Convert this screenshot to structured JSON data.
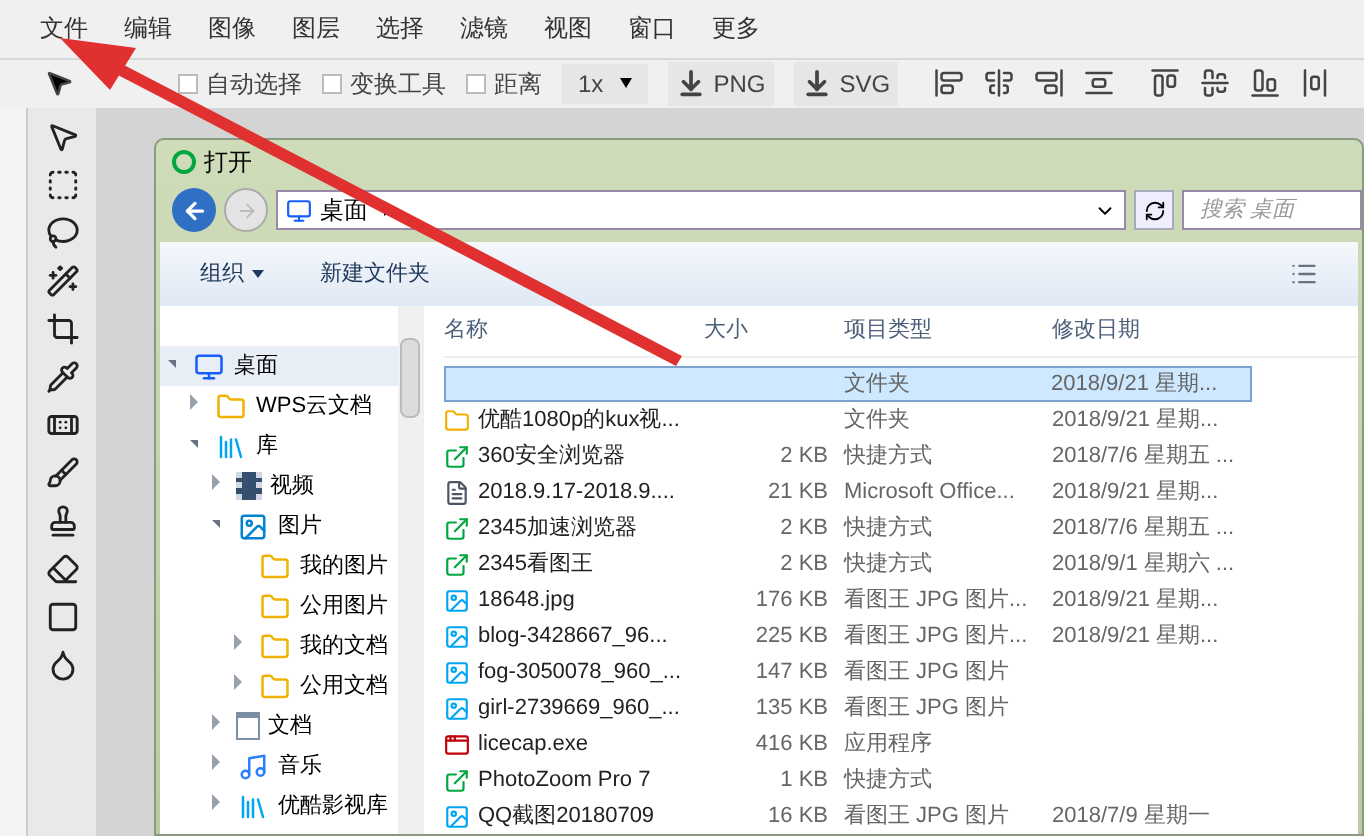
{
  "menu": [
    "文件",
    "编辑",
    "图像",
    "图层",
    "选择",
    "滤镜",
    "视图",
    "窗口",
    "更多"
  ],
  "options": {
    "checkboxes": [
      {
        "label": "自动选择",
        "checked": false
      },
      {
        "label": "变换工具",
        "checked": false
      },
      {
        "label": "距离",
        "checked": false
      }
    ],
    "scale": "1x",
    "exports": [
      "PNG",
      "SVG"
    ]
  },
  "dialog": {
    "title": "打开",
    "address": "桌面",
    "search": {
      "placeholder": "搜索 桌面"
    },
    "toolbar": {
      "organize": "组织",
      "new_folder": "新建文件夹"
    },
    "tree": [
      {
        "label": "桌面",
        "kind": "desktop",
        "expanded": true,
        "selected": true,
        "children": [
          {
            "label": "WPS云文档",
            "kind": "folder",
            "expanded": false,
            "selected": false
          },
          {
            "label": "库",
            "kind": "library",
            "expanded": true,
            "selected": false,
            "children": [
              {
                "label": "视频",
                "kind": "video",
                "expanded": false,
                "selected": false
              },
              {
                "label": "图片",
                "kind": "pictures",
                "expanded": true,
                "selected": false,
                "children": [
                  {
                    "label": "我的图片",
                    "kind": "folder",
                    "selected": false
                  },
                  {
                    "label": "公用图片",
                    "kind": "folder",
                    "selected": false
                  },
                  {
                    "label": "我的文档",
                    "kind": "folder",
                    "expanded": false,
                    "selected": false
                  },
                  {
                    "label": "公用文档",
                    "kind": "folder",
                    "expanded": false,
                    "selected": false
                  }
                ]
              },
              {
                "label": "文档",
                "kind": "document",
                "expanded": false,
                "selected": false
              },
              {
                "label": "音乐",
                "kind": "music",
                "expanded": false,
                "selected": false
              },
              {
                "label": "优酷影视库",
                "kind": "library",
                "expanded": false,
                "selected": false
              }
            ]
          }
        ]
      }
    ],
    "columns": [
      "名称",
      "大小",
      "项目类型",
      "修改日期"
    ],
    "files": [
      {
        "kind": "folder",
        "type": "文件夹",
        "date": "2018/9/21 星期...",
        "selected": true
      },
      {
        "kind": "folder",
        "name": "优酷1080p的kux视...",
        "type": "文件夹",
        "date": "2018/9/21 星期...",
        "selected": false
      },
      {
        "kind": "shortcut",
        "name": "360安全浏览器",
        "size": "2 KB",
        "type": "快捷方式",
        "date": "2018/7/6 星期五 ...",
        "selected": false
      },
      {
        "kind": "document",
        "name": "2018.9.17-2018.9....",
        "size": "21 KB",
        "type": "Microsoft Office...",
        "date": "2018/9/21 星期...",
        "selected": false
      },
      {
        "kind": "shortcut",
        "name": "2345加速浏览器",
        "size": "2 KB",
        "type": "快捷方式",
        "date": "2018/7/6 星期五 ...",
        "selected": false
      },
      {
        "kind": "shortcut",
        "name": "2345看图王",
        "size": "2 KB",
        "type": "快捷方式",
        "date": "2018/9/1 星期六 ...",
        "selected": false
      },
      {
        "kind": "image",
        "name": "18648.jpg",
        "size": "176 KB",
        "type": "看图王 JPG 图片...",
        "date": "2018/9/21 星期...",
        "selected": false
      },
      {
        "kind": "image",
        "name": "blog-3428667_96...",
        "size": "225 KB",
        "type": "看图王 JPG 图片...",
        "date": "2018/9/21 星期...",
        "selected": false
      },
      {
        "kind": "image",
        "name": "fog-3050078_960_...",
        "size": "147 KB",
        "type": "看图王 JPG 图片",
        "selected": false
      },
      {
        "kind": "image",
        "name": "girl-2739669_960_...",
        "size": "135 KB",
        "type": "看图王 JPG 图片",
        "selected": false
      },
      {
        "kind": "program",
        "name": "licecap.exe",
        "size": "416 KB",
        "type": "应用程序",
        "selected": false
      },
      {
        "kind": "shortcut",
        "name": "PhotoZoom Pro 7",
        "size": "1 KB",
        "type": "快捷方式",
        "selected": false
      },
      {
        "kind": "image",
        "name": "QQ截图20180709",
        "size": "16 KB",
        "type": "看图王 JPG 图片",
        "date": "2018/7/9 星期一",
        "selected": false
      }
    ]
  }
}
